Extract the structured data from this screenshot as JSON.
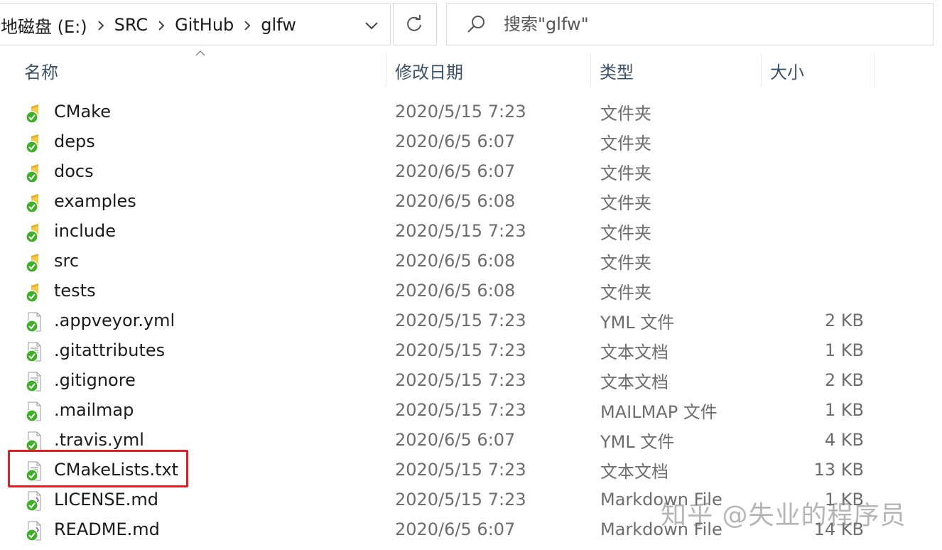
{
  "address_bar": {
    "crumbs": [
      "地磁盘 (E:)",
      "SRC",
      "GitHub",
      "glfw"
    ]
  },
  "search": {
    "placeholder": "搜索\"glfw\""
  },
  "columns": {
    "name": "名称",
    "date": "修改日期",
    "type": "类型",
    "size": "大小"
  },
  "files": [
    {
      "name": "CMake",
      "date": "2020/5/15 7:23",
      "type": "文件夹",
      "size": "",
      "kind": "folder"
    },
    {
      "name": "deps",
      "date": "2020/6/5 6:07",
      "type": "文件夹",
      "size": "",
      "kind": "folder"
    },
    {
      "name": "docs",
      "date": "2020/6/5 6:07",
      "type": "文件夹",
      "size": "",
      "kind": "folder"
    },
    {
      "name": "examples",
      "date": "2020/6/5 6:08",
      "type": "文件夹",
      "size": "",
      "kind": "folder"
    },
    {
      "name": "include",
      "date": "2020/5/15 7:23",
      "type": "文件夹",
      "size": "",
      "kind": "folder"
    },
    {
      "name": "src",
      "date": "2020/6/5 6:08",
      "type": "文件夹",
      "size": "",
      "kind": "folder"
    },
    {
      "name": "tests",
      "date": "2020/6/5 6:08",
      "type": "文件夹",
      "size": "",
      "kind": "folder"
    },
    {
      "name": ".appveyor.yml",
      "date": "2020/5/15 7:23",
      "type": "YML 文件",
      "size": "2 KB",
      "kind": "file"
    },
    {
      "name": ".gitattributes",
      "date": "2020/5/15 7:23",
      "type": "文本文档",
      "size": "1 KB",
      "kind": "text"
    },
    {
      "name": ".gitignore",
      "date": "2020/5/15 7:23",
      "type": "文本文档",
      "size": "2 KB",
      "kind": "text"
    },
    {
      "name": ".mailmap",
      "date": "2020/5/15 7:23",
      "type": "MAILMAP 文件",
      "size": "1 KB",
      "kind": "file"
    },
    {
      "name": ".travis.yml",
      "date": "2020/6/5 6:07",
      "type": "YML 文件",
      "size": "4 KB",
      "kind": "file"
    },
    {
      "name": "CMakeLists.txt",
      "date": "2020/5/15 7:23",
      "type": "文本文档",
      "size": "13 KB",
      "kind": "text"
    },
    {
      "name": "LICENSE.md",
      "date": "2020/5/15 7:23",
      "type": "Markdown File",
      "size": "1 KB",
      "kind": "markdown"
    },
    {
      "name": "README.md",
      "date": "2020/6/5 6:07",
      "type": "Markdown File",
      "size": "14 KB",
      "kind": "markdown"
    }
  ],
  "watermark": "知乎 @失业的程序员",
  "colors": {
    "header_text": "#3a5069",
    "detail_text": "#6d6d6d",
    "overlay_check": "#3fae29",
    "folder": "#f4c84a",
    "highlight_box": "#e02020"
  }
}
